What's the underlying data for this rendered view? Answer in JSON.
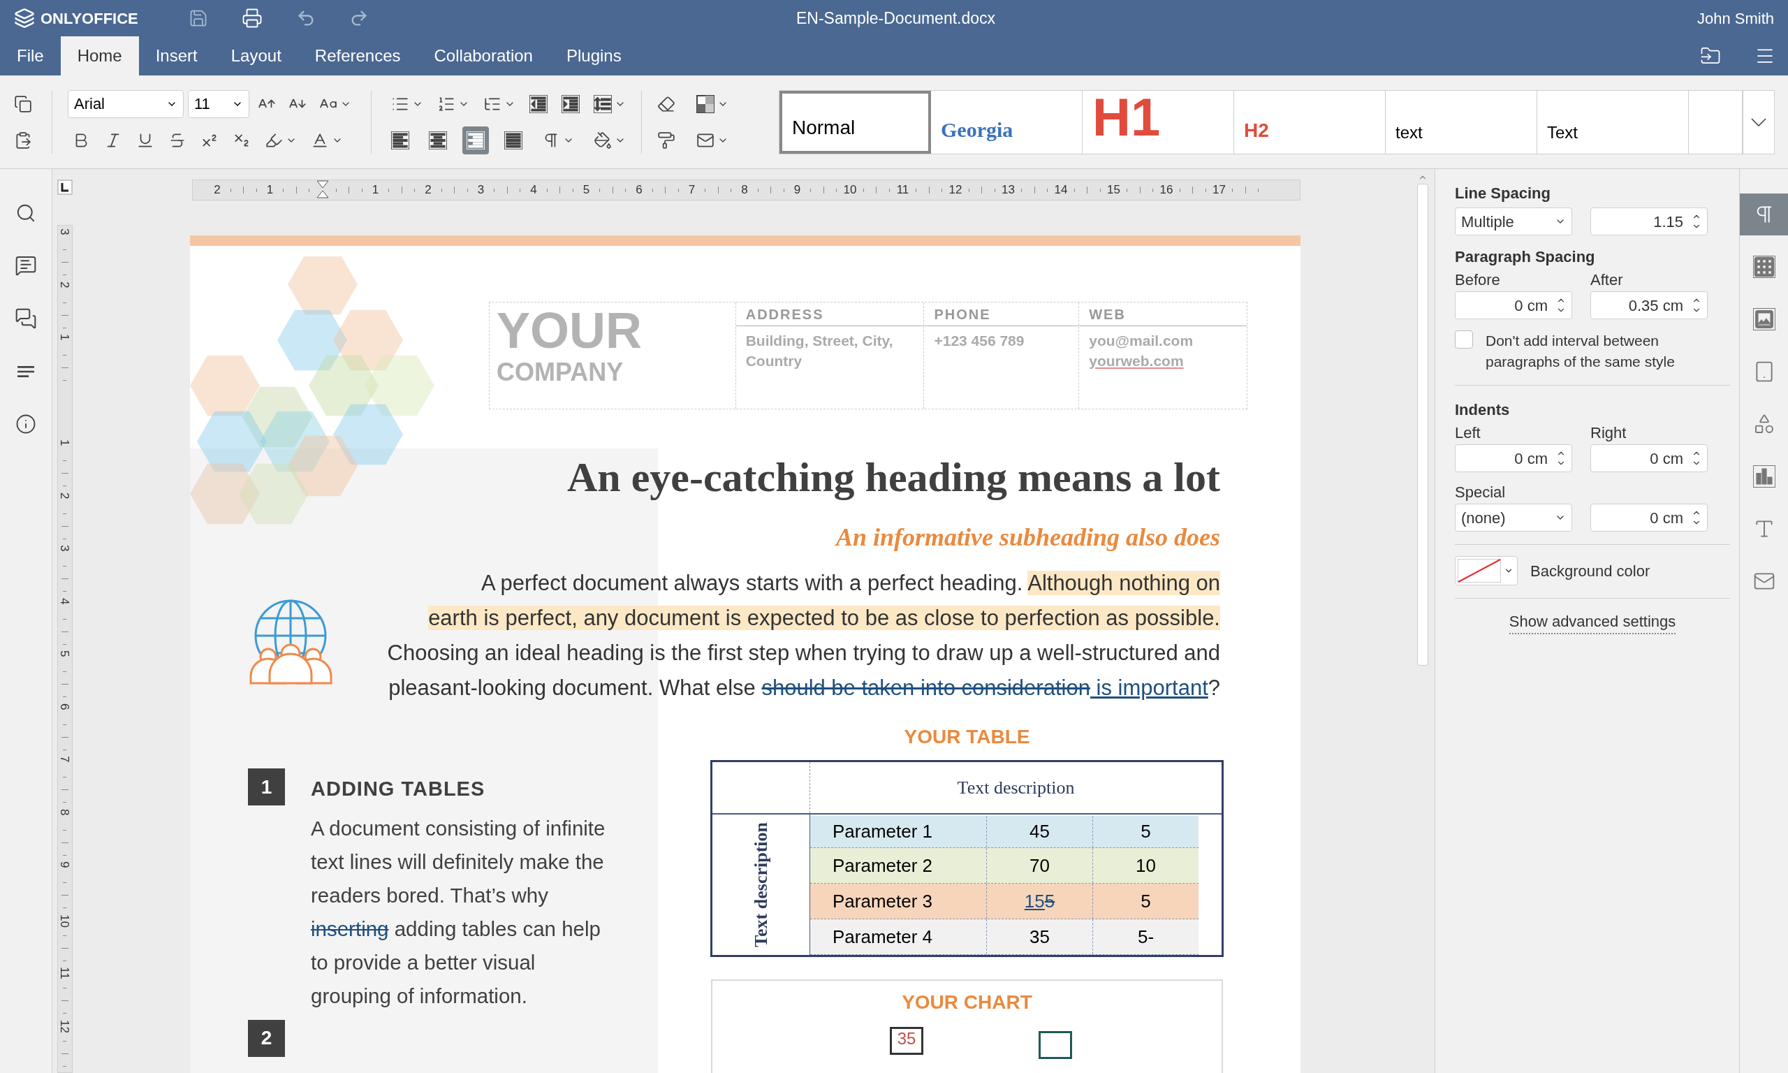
{
  "app": {
    "logo": "ONLYOFFICE",
    "title": "EN-Sample-Document.docx",
    "user": "John Smith"
  },
  "menu_tabs": [
    {
      "label": "File",
      "selected": false
    },
    {
      "label": "Home",
      "selected": true
    },
    {
      "label": "Insert",
      "selected": false
    },
    {
      "label": "Layout",
      "selected": false
    },
    {
      "label": "References",
      "selected": false
    },
    {
      "label": "Collaboration",
      "selected": false
    },
    {
      "label": "Plugins",
      "selected": false
    }
  ],
  "toolbar": {
    "font": "Arial",
    "size": "11",
    "alignment": [
      {
        "kind": "left",
        "selected": false
      },
      {
        "kind": "center",
        "selected": false
      },
      {
        "kind": "right",
        "selected": true
      },
      {
        "kind": "justify",
        "selected": false
      }
    ]
  },
  "styles": [
    {
      "label": "Normal",
      "kind": "normal",
      "selected": true
    },
    {
      "label": "Georgia",
      "kind": "title",
      "selected": false
    },
    {
      "label": "H1",
      "kind": "heading1",
      "selected": false
    },
    {
      "label": "H2",
      "kind": "heading2",
      "selected": false
    },
    {
      "label": "text",
      "kind": "plain",
      "selected": false
    },
    {
      "label": "Text",
      "kind": "plain",
      "selected": false
    },
    {
      "kind": "empty",
      "selected": false
    }
  ],
  "ruler": {
    "before": [
      "2",
      "1"
    ],
    "after": [
      "1",
      "2",
      "3",
      "4",
      "5",
      "6",
      "7",
      "8",
      "9",
      "10",
      "11",
      "12",
      "13",
      "14",
      "15",
      "16",
      "17"
    ]
  },
  "vertical_ruler": {
    "before": [
      "3",
      "2",
      "1"
    ],
    "after": [
      "1",
      "2",
      "3",
      "4",
      "5",
      "6",
      "7",
      "8",
      "9",
      "10",
      "11",
      "12"
    ]
  },
  "document": {
    "company": {
      "line1": "YOUR",
      "line2": "COMPANY"
    },
    "contacts": [
      {
        "heading": "ADDRESS",
        "lines": [
          "Building, Street, City, Country"
        ]
      },
      {
        "heading": "PHONE",
        "lines": [
          "+123 456 789"
        ]
      },
      {
        "heading": "WEB",
        "lines": [
          "you@mail.com",
          "yourweb.com"
        ]
      }
    ],
    "heading": "An eye-catching heading means a lot",
    "subheading": "An informative subheading also does",
    "intro": [
      {
        "kind": "plain",
        "text": "A perfect document always starts with a perfect heading. "
      },
      {
        "kind": "highlight",
        "text": "Although nothing on earth is perfect, any document is expected to be as close to perfection as possible."
      },
      {
        "kind": "plain",
        "text": " Choosing an ideal heading is the first step when trying to draw up a well-structured and pleasant-looking document. What else "
      },
      {
        "kind": "deleted",
        "text": "should be taken into consideration"
      },
      {
        "kind": "inserted",
        "text": " is important"
      },
      {
        "kind": "plain",
        "text": "?"
      }
    ],
    "section": {
      "number": "1",
      "title": "ADDING TABLES",
      "runs": [
        {
          "kind": "plain",
          "text": "A document consisting of infinite text lines will definitely make the readers bored. That’s why "
        },
        {
          "kind": "deleted",
          "text": "inserting"
        },
        {
          "kind": "plain",
          "text": " adding tables can help to provide a better visual grouping of information."
        }
      ]
    },
    "next_number": "2",
    "table_title": "YOUR TABLE",
    "table": {
      "column_header": "Text description",
      "row_header": "Text description",
      "rows": [
        {
          "color": "#d7e9f0",
          "cells": [
            "Parameter 1",
            "45",
            "5"
          ]
        },
        {
          "color": "#e9efd6",
          "cells": [
            "Parameter 2",
            "70",
            "10"
          ]
        },
        {
          "color": "#f6d5bb",
          "cells": [
            "Parameter 3",
            [
              {
                "kind": "inserted",
                "text": "15"
              },
              {
                "kind": "deleted",
                "text": "5"
              }
            ],
            "5"
          ]
        },
        {
          "color": "#f1f1f1",
          "cells": [
            "Parameter 4",
            "35",
            "5-"
          ]
        }
      ]
    },
    "chart": {
      "title": "YOUR CHART",
      "label": "35"
    }
  },
  "panel": {
    "line_spacing": {
      "label": "Line Spacing",
      "type": "Multiple",
      "value": "1.15"
    },
    "paragraph_spacing": {
      "label": "Paragraph Spacing",
      "before_label": "Before",
      "before": "0 cm",
      "after_label": "After",
      "after": "0.35 cm"
    },
    "no_interval": {
      "label": "Don't add interval between paragraphs of the same style",
      "checked": false
    },
    "indents": {
      "label": "Indents",
      "left_label": "Left",
      "left": "0 cm",
      "right_label": "Right",
      "right": "0 cm",
      "special_label": "Special",
      "special": "(none)",
      "special_value": "0 cm"
    },
    "background": {
      "label": "Background color"
    },
    "advanced": "Show advanced settings"
  },
  "right_rail": [
    {
      "kind": "paragraph",
      "selected": true
    },
    {
      "kind": "table",
      "selected": false
    },
    {
      "kind": "image",
      "selected": false
    },
    {
      "kind": "header",
      "selected": false
    },
    {
      "kind": "shape",
      "selected": false
    },
    {
      "kind": "chart",
      "selected": false
    },
    {
      "kind": "textart",
      "selected": false
    },
    {
      "kind": "mail",
      "selected": false
    }
  ]
}
